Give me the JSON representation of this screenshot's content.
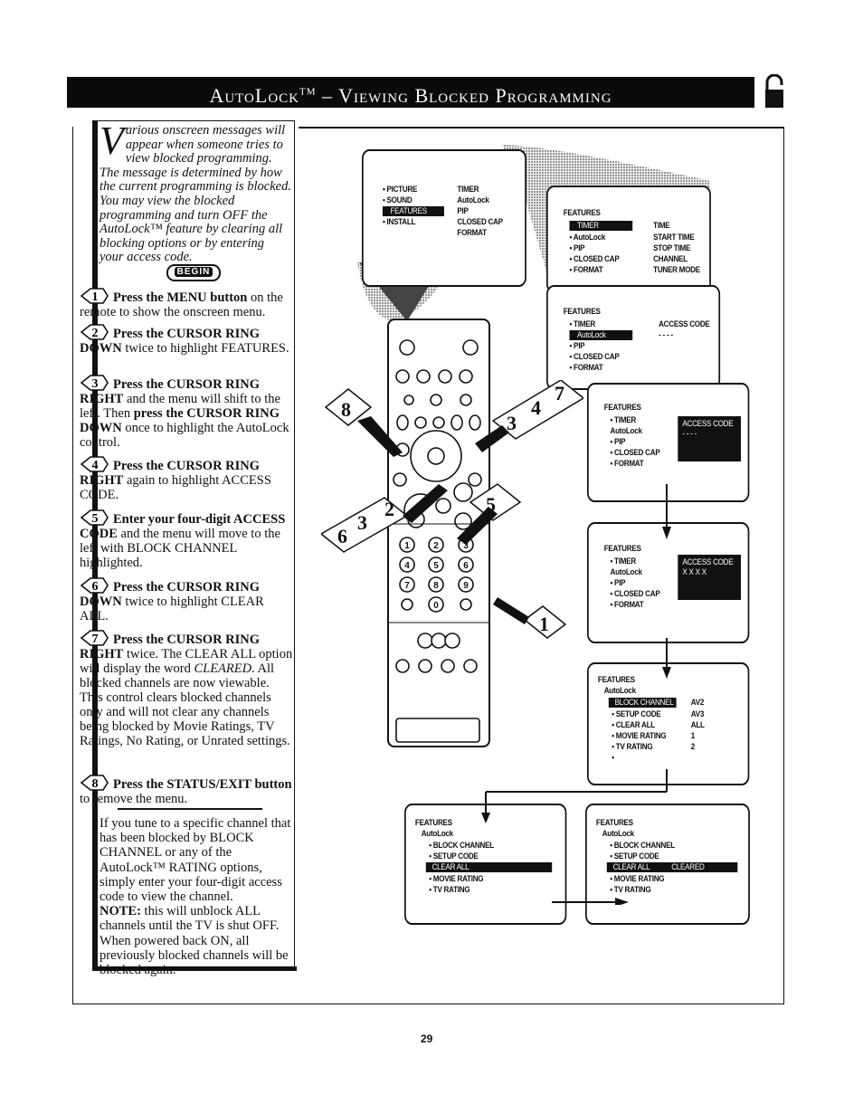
{
  "header": {
    "title_main": "AutoLock",
    "title_tm": "TM",
    "title_rest": " – Viewing Blocked Programming",
    "lock_icon": "open-padlock-icon"
  },
  "intro": {
    "dropcap": "V",
    "text": "arious onscreen messages will appear when someone tries to view blocked programming. The message is determined by how the current programming is blocked. You may view the blocked programming and turn OFF the AutoLock™ feature by clearing all blocking options or by entering your access code.",
    "begin_label": "BEGIN"
  },
  "steps": [
    {
      "num": "1",
      "bold": "Press the MENU button",
      "rest": " on the remote to show the onscreen menu."
    },
    {
      "num": "2",
      "bold": "Press the CURSOR RING DOWN",
      "rest": " twice to highlight FEATURES."
    },
    {
      "num": "3",
      "bold": "Press the CURSOR RING RIGHT",
      "rest": " and the menu will shift to the left. Then ",
      "bold2": "press the CURSOR RING DOWN",
      "rest2": " once to highlight the AutoLock control."
    },
    {
      "num": "4",
      "bold": "Press the CURSOR RING RIGHT",
      "rest": " again to highlight ACCESS CODE."
    },
    {
      "num": "5",
      "bold": "Enter your four-digit ACCESS CODE",
      "rest": " and the menu will move to the left with BLOCK CHANNEL highlighted."
    },
    {
      "num": "6",
      "bold": "Press the CURSOR RING DOWN",
      "rest": " twice to highlight CLEAR ALL."
    },
    {
      "num": "7",
      "bold": "Press the CURSOR RING RIGHT",
      "rest": " twice. The CLEAR ALL option will display the word ",
      "italic": "CLEARED",
      "rest2": ". All blocked channels are now viewable. This control clears blocked channels only and will not clear any channels being blocked by Movie Ratings, TV Ratings, No Rating, or Unrated settings."
    },
    {
      "num": "8",
      "bold": "Press the STATUS/EXIT button",
      "rest": " to remove the menu."
    }
  ],
  "note": {
    "text1": "If you tune to a specific channel that has been blocked by BLOCK CHANNEL or any of the AutoLock™ RATING options, simply enter your four-digit access code to view the channel.",
    "note_label": "NOTE:",
    "text2": " this will unblock ALL channels until the TV is shut OFF. When powered back ON, all previously blocked channels will be blocked again."
  },
  "menus": {
    "main": {
      "left": [
        "• PICTURE",
        "• SOUND",
        "FEATURES",
        "• INSTALL"
      ],
      "right": [
        "TIMER",
        "AutoLock",
        "PIP",
        "CLOSED CAP",
        "FORMAT"
      ],
      "highlight": "FEATURES"
    },
    "features1": {
      "title": "FEATURES",
      "left": [
        "TIMER",
        "• AutoLock",
        "• PIP",
        "• CLOSED CAP",
        "• FORMAT"
      ],
      "right": [
        "TIME",
        "START TIME",
        "STOP TIME",
        "CHANNEL",
        "TUNER MODE"
      ]
    },
    "features2": {
      "title": "FEATURES",
      "left": [
        "• TIMER",
        "AutoLock",
        "• PIP",
        "• CLOSED CAP",
        "• FORMAT"
      ],
      "right_label": "ACCESS CODE",
      "right_value": "- - - -"
    },
    "features3": {
      "title": "FEATURES",
      "left": [
        "• TIMER",
        "AutoLock",
        "• PIP",
        "• CLOSED CAP",
        "• FORMAT"
      ],
      "box_label": "ACCESS CODE",
      "box_value": "- - - -"
    },
    "features4": {
      "title": "FEATURES",
      "left": [
        "• TIMER",
        "AutoLock",
        "• PIP",
        "• CLOSED CAP",
        "• FORMAT"
      ],
      "box_label": "ACCESS CODE",
      "box_value": "X X X X"
    },
    "autolock1": {
      "title": "FEATURES",
      "sub": "AutoLock",
      "items": [
        "BLOCK CHANNEL",
        "• SETUP CODE",
        "• CLEAR ALL",
        "• MOVIE RATING",
        "• TV RATING",
        "•"
      ],
      "values": [
        "AV2",
        "AV3",
        "ALL",
        "1",
        "2"
      ]
    },
    "autolock2": {
      "title": "FEATURES",
      "sub": "AutoLock",
      "items": [
        "• BLOCK CHANNEL",
        "• SETUP CODE",
        "CLEAR ALL",
        "• MOVIE RATING",
        "• TV RATING"
      ]
    },
    "autolock3": {
      "title": "FEATURES",
      "sub": "AutoLock",
      "items": [
        "• BLOCK CHANNEL",
        "• SETUP CODE",
        "CLEAR ALL",
        "• MOVIE RATING",
        "• TV RATING"
      ],
      "cleared": "CLEARED"
    }
  },
  "remote": {
    "keypad": [
      "1",
      "2",
      "3",
      "4",
      "5",
      "6",
      "7",
      "8",
      "9",
      "0"
    ],
    "pointer_tags": [
      "8",
      "2",
      "3",
      "6",
      "3",
      "4",
      "7",
      "5",
      "1"
    ]
  },
  "footer": {
    "page_number": "29"
  }
}
